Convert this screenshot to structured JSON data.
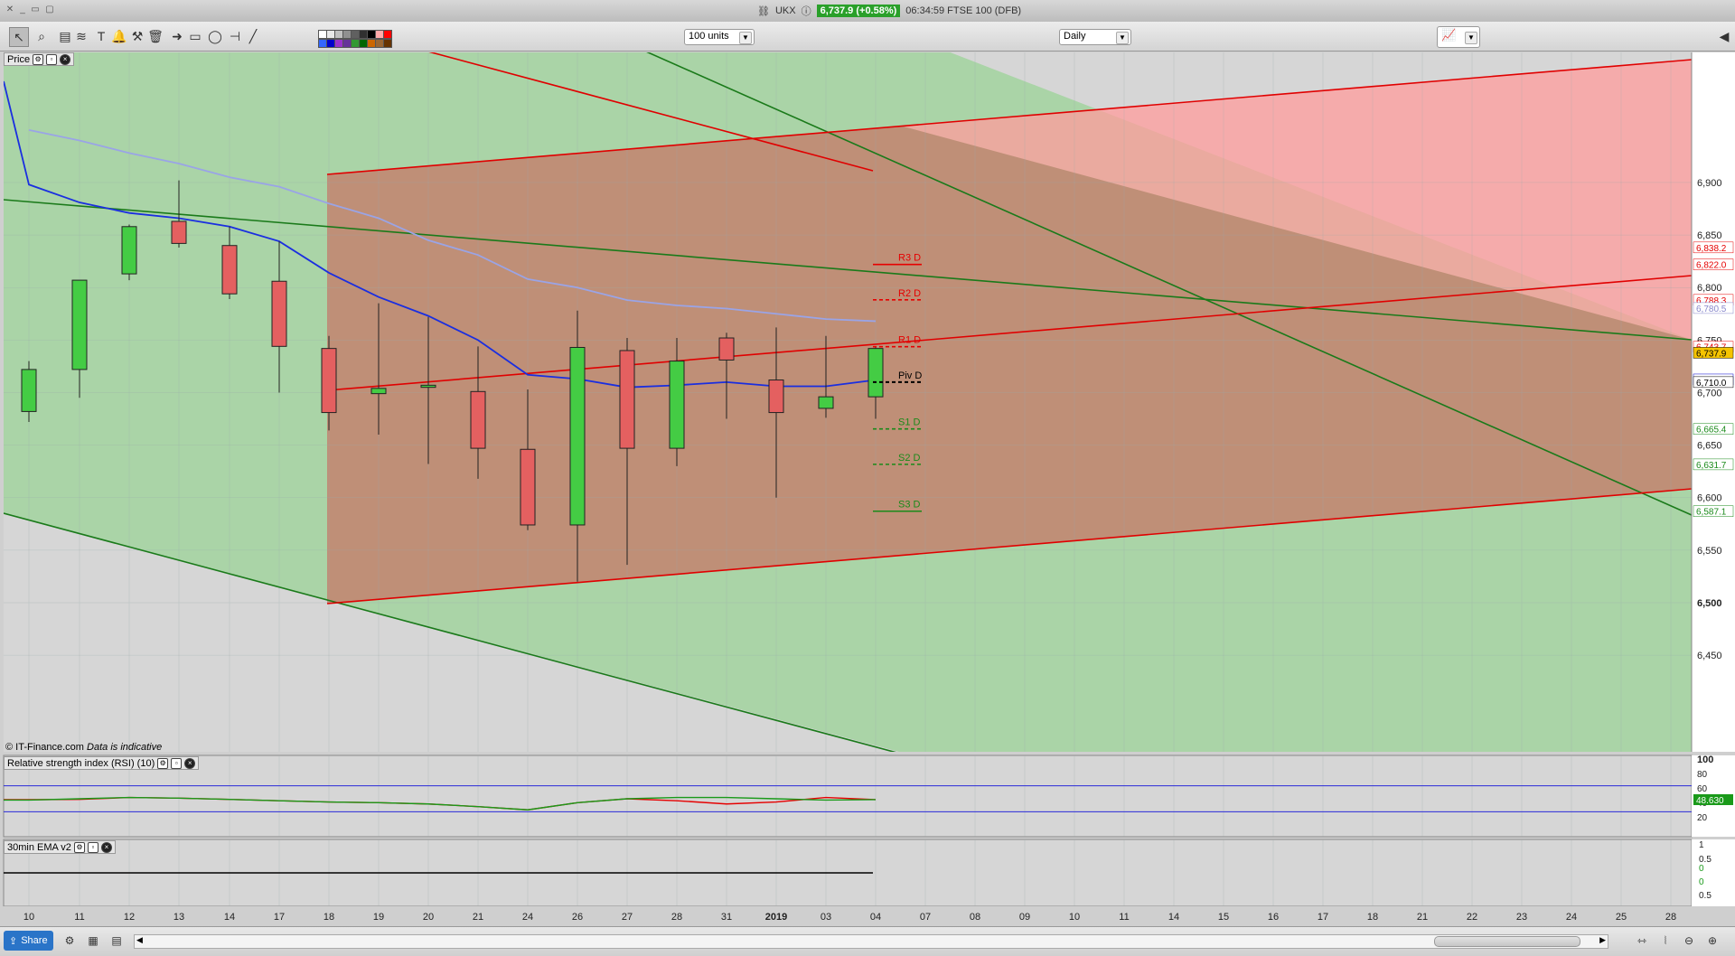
{
  "window": {
    "symbol": "UKX",
    "price_badge": "6,737.9 (+0.58%)",
    "info": "06:34:59 FTSE 100 (DFB)"
  },
  "toolbar": {
    "units": "100 units",
    "interval": "Daily",
    "tools": [
      "pointer-icon",
      "zoom-icon",
      "fibonacci-icon",
      "text-icon",
      "raff-channel-icon",
      "alert-icon",
      "hammer-icon",
      "trash-icon",
      "arrow-icon",
      "rectangle-icon",
      "ellipse-icon",
      "horizontal-line-icon",
      "trend-line-icon"
    ],
    "colors": [
      "#ffffff",
      "#e8e8e8",
      "#c0c0c0",
      "#909090",
      "#606060",
      "#303030",
      "#000000",
      "#ffaaaa",
      "#ff0000",
      "#3366ff",
      "#0000cc",
      "#9933cc",
      "#663399",
      "#339933",
      "#006600",
      "#cc6600",
      "#996633",
      "#663300"
    ]
  },
  "price_panel": {
    "label": "Price",
    "copyright": "© IT-Finance.com",
    "disclaimer": "Data is indicative"
  },
  "rsi_panel": {
    "label": "Relative strength index (RSI) (10)",
    "ticks": [
      "100",
      "80",
      "60",
      "40",
      "20"
    ],
    "value_tag": "48.630"
  },
  "ema_panel": {
    "label": "30min EMA v2",
    "ticks": [
      "1",
      "0.5",
      "0",
      "0",
      "0.5"
    ]
  },
  "pivots": [
    {
      "label": "R3 D",
      "value": 6822.0,
      "color": "#e60000",
      "style": "solid"
    },
    {
      "label": "R2 D",
      "value": 6788.3,
      "color": "#e60000",
      "style": "dashed"
    },
    {
      "label": "R1 D",
      "value": 6743.7,
      "color": "#e60000",
      "style": "dashed"
    },
    {
      "label": "Piv D",
      "value": 6710.0,
      "color": "#000000",
      "style": "dashed"
    },
    {
      "label": "S1 D",
      "value": 6665.4,
      "color": "#1a8a1a",
      "style": "dashed"
    },
    {
      "label": "S2 D",
      "value": 6631.7,
      "color": "#1a8a1a",
      "style": "dashed"
    },
    {
      "label": "S3 D",
      "value": 6587.1,
      "color": "#1a8a1a",
      "style": "solid"
    }
  ],
  "price_tags": [
    {
      "text": "6,838.2",
      "value": 6838.2,
      "color": "#e60000",
      "bg": "#ffffff"
    },
    {
      "text": "6,822.0",
      "value": 6822.0,
      "color": "#e60000",
      "bg": "#ffffff"
    },
    {
      "text": "6,788.3",
      "value": 6788.3,
      "color": "#e60000",
      "bg": "#ffffff"
    },
    {
      "text": "6,780.5",
      "value": 6780.5,
      "color": "#8888cc",
      "bg": "#ffffff"
    },
    {
      "text": "6,743.7",
      "value": 6743.7,
      "color": "#e60000",
      "bg": "#ffffff"
    },
    {
      "text": "6,737.9",
      "value": 6737.9,
      "color": "#000000",
      "bg": "#f5c400"
    },
    {
      "text": "6,712.5",
      "value": 6712.5,
      "color": "#0000cc",
      "bg": "#ffffff"
    },
    {
      "text": "6,710.0",
      "value": 6710.0,
      "color": "#000000",
      "bg": "#ffffff"
    },
    {
      "text": "6,665.4",
      "value": 6665.4,
      "color": "#1a8a1a",
      "bg": "#ffffff"
    },
    {
      "text": "6,631.7",
      "value": 6631.7,
      "color": "#1a8a1a",
      "bg": "#ffffff"
    },
    {
      "text": "6,587.1",
      "value": 6587.1,
      "color": "#1a8a1a",
      "bg": "#ffffff"
    }
  ],
  "chart_data": {
    "type": "candlestick",
    "y_ticks": [
      "6,900",
      "6,850",
      "6,800",
      "6,750",
      "6,700",
      "6,650",
      "6,600",
      "6,550",
      "6,500",
      "6,450"
    ],
    "y_tick_values": [
      6900,
      6850,
      6800,
      6750,
      6700,
      6650,
      6600,
      6550,
      6500,
      6450
    ],
    "ylim": [
      6385,
      6930
    ],
    "x_labels": [
      "10",
      "11",
      "12",
      "13",
      "14",
      "17",
      "18",
      "19",
      "20",
      "21",
      "24",
      "26",
      "27",
      "28",
      "31",
      "2019",
      "03",
      "04",
      "07",
      "08",
      "09",
      "10",
      "11",
      "14",
      "15",
      "16",
      "17",
      "18",
      "21",
      "22",
      "23",
      "24",
      "25",
      "28"
    ],
    "candles": [
      {
        "o": 6682,
        "h": 6730,
        "l": 6672,
        "c": 6722
      },
      {
        "o": 6722,
        "h": 6771,
        "l": 6695,
        "c": 6807
      },
      {
        "o": 6813,
        "h": 6860,
        "l": 6807,
        "c": 6858
      },
      {
        "o": 6863,
        "h": 6902,
        "l": 6838,
        "c": 6842
      },
      {
        "o": 6840,
        "h": 6858,
        "l": 6789,
        "c": 6794
      },
      {
        "o": 6806,
        "h": 6844,
        "l": 6700,
        "c": 6744
      },
      {
        "o": 6742,
        "h": 6754,
        "l": 6664,
        "c": 6681
      },
      {
        "o": 6699,
        "h": 6785,
        "l": 6660,
        "c": 6704
      },
      {
        "o": 6705,
        "h": 6772,
        "l": 6632,
        "c": 6707
      },
      {
        "o": 6701,
        "h": 6744,
        "l": 6618,
        "c": 6647
      },
      {
        "o": 6646,
        "h": 6703,
        "l": 6569,
        "c": 6574
      },
      {
        "o": 6574,
        "h": 6778,
        "l": 6520,
        "c": 6743
      },
      {
        "o": 6740,
        "h": 6752,
        "l": 6536,
        "c": 6647
      },
      {
        "o": 6647,
        "h": 6752,
        "l": 6630,
        "c": 6730
      },
      {
        "o": 6752,
        "h": 6757,
        "l": 6675,
        "c": 6731
      },
      {
        "o": 6712,
        "h": 6762,
        "l": 6600,
        "c": 6681
      },
      {
        "o": 6685,
        "h": 6754,
        "l": 6676,
        "c": 6696
      },
      {
        "o": 6696,
        "h": 6744,
        "l": 6675,
        "c": 6742
      }
    ],
    "ema_blue": [
      6898,
      6881,
      6871,
      6866,
      6858,
      6844,
      6814,
      6791,
      6773,
      6750,
      6717,
      6713,
      6705,
      6707,
      6710,
      6706,
      6706,
      6712
    ],
    "ma_lavender": [
      6950,
      6940,
      6928,
      6918,
      6905,
      6896,
      6880,
      6866,
      6845,
      6831,
      6808,
      6800,
      6788,
      6783,
      6780,
      6775,
      6770,
      6768
    ],
    "rsi_red": [
      48.6,
      49.0,
      52,
      51,
      49,
      47,
      45,
      44,
      42,
      38,
      33,
      44,
      50,
      47,
      42,
      45,
      52,
      48.63
    ],
    "rsi_green": [
      48,
      50,
      52,
      51,
      49,
      47,
      45,
      44,
      42,
      38,
      33,
      44,
      50,
      52,
      52,
      50,
      48,
      48.63
    ]
  }
}
